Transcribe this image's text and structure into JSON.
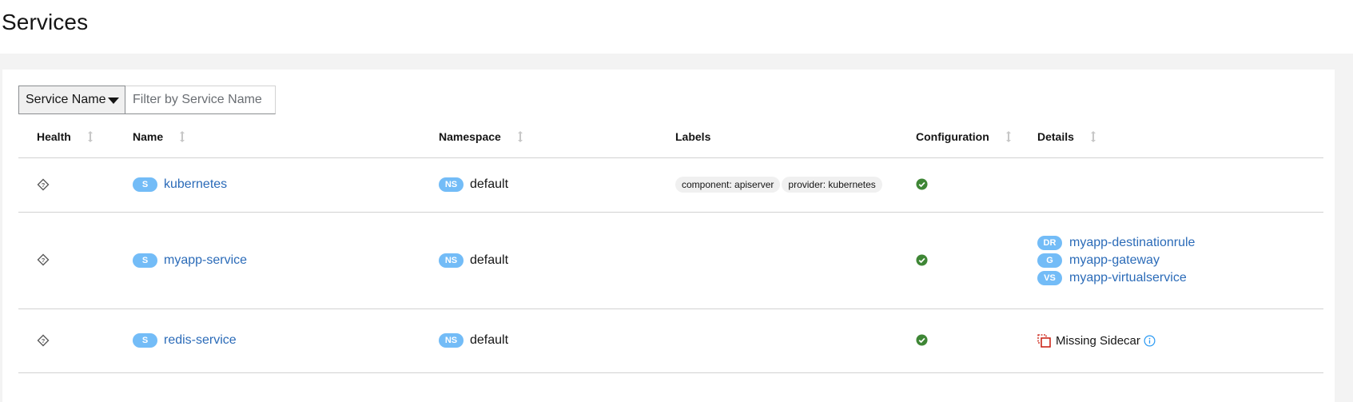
{
  "page": {
    "title": "Services"
  },
  "filter": {
    "select_label": "Service Name",
    "input_placeholder": "Filter by Service Name"
  },
  "table": {
    "columns": [
      {
        "label": "Health",
        "sortable": true
      },
      {
        "label": "Name",
        "sortable": true
      },
      {
        "label": "Namespace",
        "sortable": true
      },
      {
        "label": "Labels",
        "sortable": false
      },
      {
        "label": "Configuration",
        "sortable": true
      },
      {
        "label": "Details",
        "sortable": true
      }
    ],
    "rows": [
      {
        "name_badge": "S",
        "name": "kubernetes",
        "ns_badge": "NS",
        "namespace": "default",
        "labels": [
          "component: apiserver",
          "provider: kubernetes"
        ],
        "details": []
      },
      {
        "name_badge": "S",
        "name": "myapp-service",
        "ns_badge": "NS",
        "namespace": "default",
        "labels": [],
        "details": [
          {
            "badge": "DR",
            "text": "myapp-destinationrule"
          },
          {
            "badge": "G",
            "text": "myapp-gateway"
          },
          {
            "badge": "VS",
            "text": "myapp-virtualservice"
          }
        ]
      },
      {
        "name_badge": "S",
        "name": "redis-service",
        "ns_badge": "NS",
        "namespace": "default",
        "labels": [],
        "missing_sidecar": "Missing Sidecar"
      }
    ]
  },
  "colors": {
    "badge": "#73bcf7",
    "link": "#2b6bb8",
    "valid": "#3e8635",
    "missing": "#c9190b",
    "info": "#2b9af3"
  },
  "icons": {
    "health": "unknown-health-icon",
    "config": "check-circle-icon",
    "missing": "missing-sidecar-icon",
    "info": "info-icon",
    "sort": "sort-icon"
  }
}
